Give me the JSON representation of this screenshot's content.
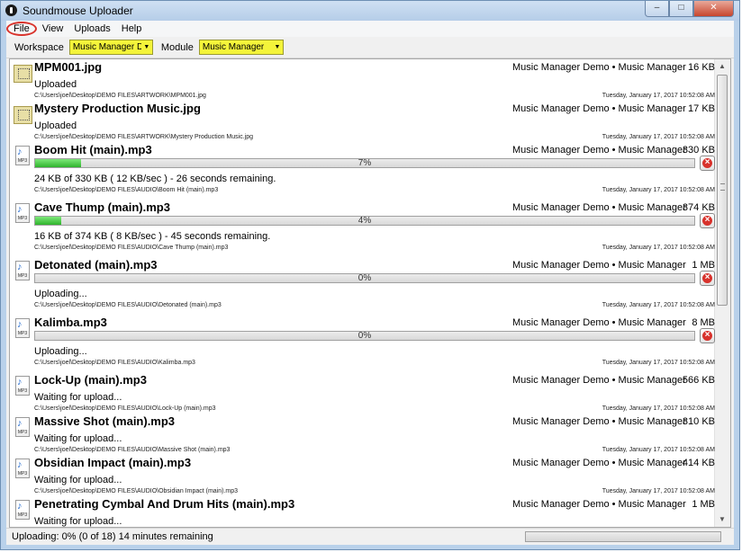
{
  "window": {
    "title": "Soundmouse Uploader",
    "min_glyph": "–",
    "max_glyph": "□",
    "close_glyph": "✕"
  },
  "menu": {
    "file": "File",
    "view": "View",
    "uploads": "Uploads",
    "help": "Help"
  },
  "toolbar": {
    "workspace_label": "Workspace",
    "workspace_value": "Music Manager Demo",
    "module_label": "Module",
    "module_value": "Music Manager",
    "dropdown_glyph": "▼"
  },
  "items": [
    {
      "name": "MPM001.jpg",
      "kind": "image",
      "workspace": "Music Manager Demo • Music Manager",
      "size": "16 KB",
      "status": "Uploaded",
      "path": "C:\\Users\\joel\\Desktop\\DEMO FILES\\ARTWORK\\MPM001.jpg",
      "time": "Tuesday, January 17, 2017 10:52:08 AM"
    },
    {
      "name": "Mystery Production Music.jpg",
      "kind": "image",
      "workspace": "Music Manager Demo • Music Manager",
      "size": "17 KB",
      "status": "Uploaded",
      "path": "C:\\Users\\joel\\Desktop\\DEMO FILES\\ARTWORK\\Mystery Production Music.jpg",
      "time": "Tuesday, January 17, 2017 10:52:08 AM"
    },
    {
      "name": "Boom Hit (main).mp3",
      "kind": "audio",
      "workspace": "Music Manager Demo • Music Manager",
      "size": "330 KB",
      "progress": 0.07,
      "progress_label": "7%",
      "status": "24 KB of 330 KB ( 12 KB/sec ) - 26 seconds remaining.",
      "path": "C:\\Users\\joel\\Desktop\\DEMO FILES\\AUDIO\\Boom Hit (main).mp3",
      "time": "Tuesday, January 17, 2017 10:52:08 AM"
    },
    {
      "name": "Cave Thump (main).mp3",
      "kind": "audio",
      "workspace": "Music Manager Demo • Music Manager",
      "size": "374 KB",
      "progress": 0.04,
      "progress_label": "4%",
      "status": "16 KB of 374 KB ( 8 KB/sec ) - 45 seconds remaining.",
      "path": "C:\\Users\\joel\\Desktop\\DEMO FILES\\AUDIO\\Cave Thump (main).mp3",
      "time": "Tuesday, January 17, 2017 10:52:08 AM"
    },
    {
      "name": "Detonated (main).mp3",
      "kind": "audio",
      "workspace": "Music Manager Demo • Music Manager",
      "size": "1 MB",
      "progress": 0,
      "progress_label": "0%",
      "status": "Uploading...",
      "path": "C:\\Users\\joel\\Desktop\\DEMO FILES\\AUDIO\\Detonated (main).mp3",
      "time": "Tuesday, January 17, 2017 10:52:08 AM"
    },
    {
      "name": "Kalimba.mp3",
      "kind": "audio",
      "workspace": "Music Manager Demo • Music Manager",
      "size": "8 MB",
      "progress": 0,
      "progress_label": "0%",
      "status": "Uploading...",
      "path": "C:\\Users\\joel\\Desktop\\DEMO FILES\\AUDIO\\Kalimba.mp3",
      "time": "Tuesday, January 17, 2017 10:52:08 AM"
    },
    {
      "name": "Lock-Up (main).mp3",
      "kind": "audio",
      "workspace": "Music Manager Demo • Music Manager",
      "size": "566 KB",
      "status": "Waiting for upload...",
      "path": "C:\\Users\\joel\\Desktop\\DEMO FILES\\AUDIO\\Lock-Up (main).mp3",
      "time": "Tuesday, January 17, 2017 10:52:08 AM"
    },
    {
      "name": "Massive Shot (main).mp3",
      "kind": "audio",
      "workspace": "Music Manager Demo • Music Manager",
      "size": "310 KB",
      "status": "Waiting for upload...",
      "path": "C:\\Users\\joel\\Desktop\\DEMO FILES\\AUDIO\\Massive Shot (main).mp3",
      "time": "Tuesday, January 17, 2017 10:52:08 AM"
    },
    {
      "name": "Obsidian Impact (main).mp3",
      "kind": "audio",
      "workspace": "Music Manager Demo • Music Manager",
      "size": "414 KB",
      "status": "Waiting for upload...",
      "path": "C:\\Users\\joel\\Desktop\\DEMO FILES\\AUDIO\\Obsidian Impact (main).mp3",
      "time": "Tuesday, January 17, 2017 10:52:08 AM"
    },
    {
      "name": "Penetrating Cymbal And Drum Hits (main).mp3",
      "kind": "audio",
      "workspace": "Music Manager Demo • Music Manager",
      "size": "1 MB",
      "status": "Waiting for upload...",
      "path": "",
      "time": ""
    }
  ],
  "statusbar": {
    "text": "Uploading: 0% (0 of 18) 14 minutes remaining",
    "progress": 0
  },
  "icons": {
    "image": "image-file-icon",
    "audio": "mp3-file-icon",
    "audio_glyph": "♪",
    "audio_ext": "MP3",
    "cancel": "cancel-upload-icon"
  },
  "colors": {
    "highlight": "#f4f43a",
    "progress_fill": "#2fb32c",
    "cancel": "#d8322c",
    "annotation": "#d9332c"
  }
}
